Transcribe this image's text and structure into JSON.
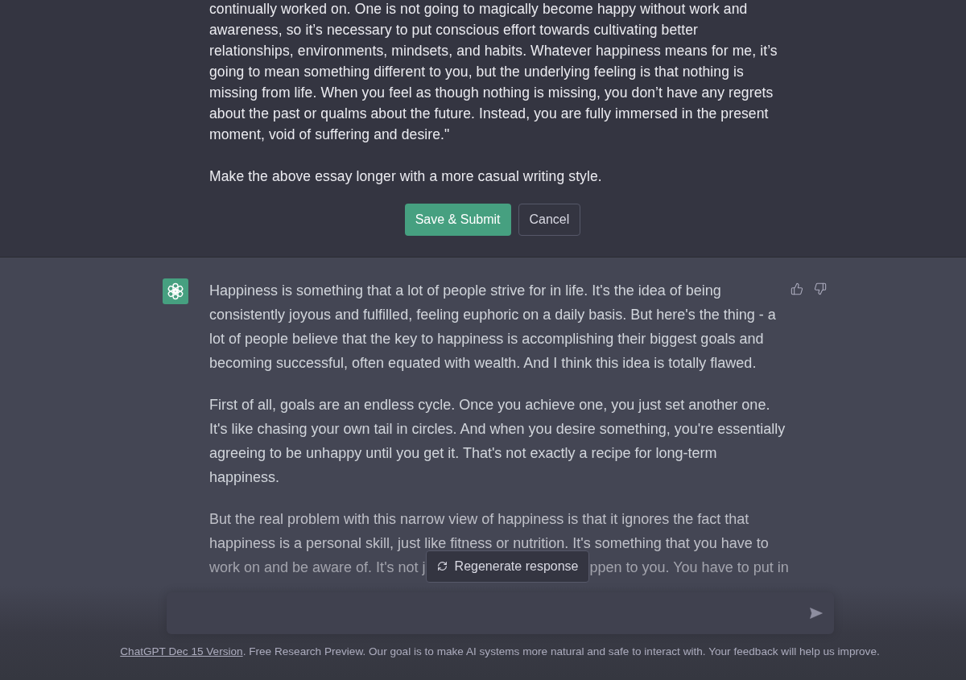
{
  "edit_message": {
    "paragraphs": [
      "continually worked on. One is not going to magically become happy without work and awareness, so it’s necessary to put conscious effort towards cultivating better relationships, environments, mindsets, and habits. Whatever happiness means for me, it’s going to mean something different to you, but the underlying feeling is that nothing is missing from life. When you feel as though nothing is missing, you don’t have any regrets about the past or qualms about the future. Instead, you are fully immersed in the present moment, void of suffering and desire.\"",
      "Make the above essay longer with a more casual writing style."
    ],
    "buttons": [
      {
        "label": "Save & Submit",
        "kind": "primary"
      },
      {
        "label": "Cancel",
        "kind": "secondary"
      }
    ]
  },
  "response": {
    "paragraphs": [
      "Happiness is something that a lot of people strive for in life. It's the idea of being consistently joyous and fulfilled, feeling euphoric on a daily basis. But here's the thing - a lot of people believe that the key to happiness is accomplishing their biggest goals and becoming successful, often equated with wealth. And I think this idea is totally flawed.",
      "First of all, goals are an endless cycle. Once you achieve one, you just set another one. It's like chasing your own tail in circles. And when you desire something, you're essentially agreeing to be unhappy until you get it. That's not exactly a recipe for long-term happiness."
    ],
    "last_paragraph": {
      "text": "But the real problem with this narrow view of happiness is that it ignores the fact that happiness is a personal skill, just like fitness or nutrition. It's something that you have to",
      "covered_line": {
        "before_overlay": "work on and be aware of. It's not j",
        "after_overlay": "ppen to you. You have to put in"
      }
    }
  },
  "regenerate_button": {
    "label": "Regenerate response"
  },
  "footer": {
    "link": "ChatGPT Dec 15 Version",
    "text": ". Free Research Preview. Our goal is to make AI systems more natural and safe to interact with. Your feedback will help us improve."
  }
}
